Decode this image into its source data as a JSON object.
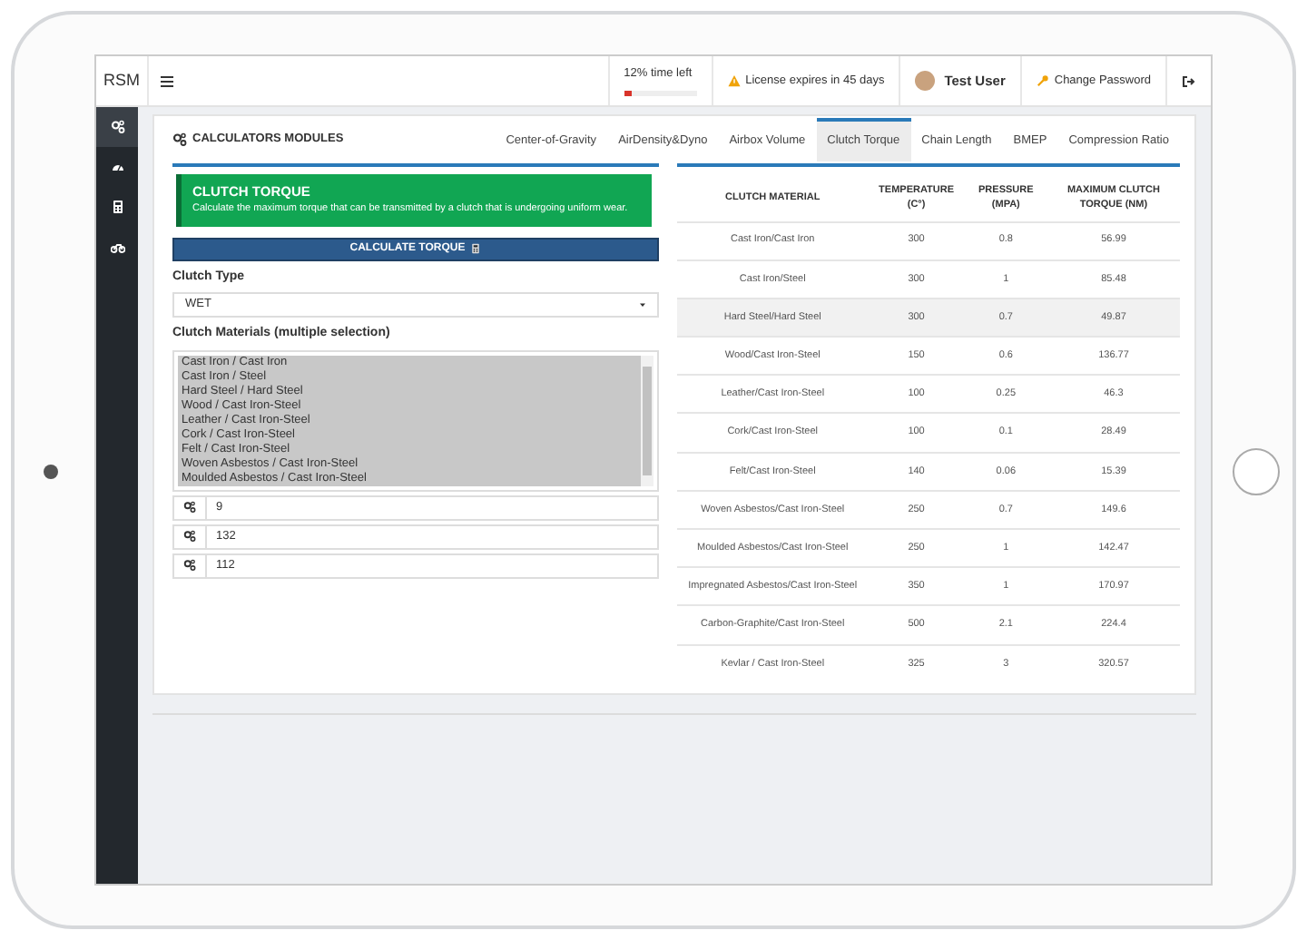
{
  "header": {
    "brand": "RSM",
    "time_left": {
      "label": "12% time left",
      "level": 0.12
    },
    "license": "License expires in 45 days",
    "user": "Test User",
    "change_password": "Change Password"
  },
  "sidebar": {
    "items": [
      {
        "kind": "gears",
        "selected": true
      },
      {
        "kind": "gauge",
        "selected": false
      },
      {
        "kind": "calculator",
        "selected": false
      },
      {
        "kind": "motorcycle",
        "selected": false
      }
    ]
  },
  "card": {
    "title": "CALCULATORS MODULES",
    "tabs": [
      {
        "label": "Center-of-Gravity",
        "selected": false
      },
      {
        "label": "AirDensity&Dyno",
        "selected": false
      },
      {
        "label": "Airbox Volume",
        "selected": false
      },
      {
        "label": "Clutch Torque",
        "selected": true
      },
      {
        "label": "Chain Length",
        "selected": false
      },
      {
        "label": "BMEP",
        "selected": false
      },
      {
        "label": "Compression Ratio",
        "selected": false
      }
    ]
  },
  "alert": {
    "title": "CLUTCH TORQUE",
    "text": "Calculate the maximum torque that can be transmitted by a clutch that is undergoing uniform wear."
  },
  "calculate_button": "CALCULATE TORQUE",
  "clutch_type": {
    "label": "Clutch Type",
    "value": "WET"
  },
  "clutch_materials": {
    "label": "Clutch Materials (multiple selection)",
    "options": [
      {
        "label": "Cast Iron / Cast Iron",
        "selected": true
      },
      {
        "label": "Cast Iron / Steel",
        "selected": true
      },
      {
        "label": "Hard Steel / Hard Steel",
        "selected": true
      },
      {
        "label": "Wood / Cast Iron-Steel",
        "selected": true
      },
      {
        "label": "Leather / Cast Iron-Steel",
        "selected": true
      },
      {
        "label": "Cork / Cast Iron-Steel",
        "selected": true
      },
      {
        "label": "Felt / Cast Iron-Steel",
        "selected": true
      },
      {
        "label": "Woven Asbestos / Cast Iron-Steel",
        "selected": true
      },
      {
        "label": "Moulded Asbestos / Cast Iron-Steel",
        "selected": true
      }
    ]
  },
  "inputs": [
    {
      "value": "9"
    },
    {
      "value": "132"
    },
    {
      "value": "112"
    }
  ],
  "table": {
    "columns": [
      "CLUTCH MATERIAL",
      "TEMPERATURE (C°)",
      "PRESSURE (MPA)",
      "MAXIMUM CLUTCH TORQUE (NM)"
    ],
    "rows": [
      {
        "cells": [
          "Cast Iron/Cast Iron",
          "300",
          "0.8",
          "56.99"
        ],
        "hovered": false
      },
      {
        "cells": [
          "Cast Iron/Steel",
          "300",
          "1",
          "85.48"
        ],
        "hovered": false
      },
      {
        "cells": [
          "Hard Steel/Hard Steel",
          "300",
          "0.7",
          "49.87"
        ],
        "hovered": true
      },
      {
        "cells": [
          "Wood/Cast Iron-Steel",
          "150",
          "0.6",
          "136.77"
        ],
        "hovered": false
      },
      {
        "cells": [
          "Leather/Cast Iron-Steel",
          "100",
          "0.25",
          "46.3"
        ],
        "hovered": false
      },
      {
        "cells": [
          "Cork/Cast Iron-Steel",
          "100",
          "0.1",
          "28.49"
        ],
        "hovered": false
      },
      {
        "cells": [
          "Felt/Cast Iron-Steel",
          "140",
          "0.06",
          "15.39"
        ],
        "hovered": false
      },
      {
        "cells": [
          "Woven Asbestos/Cast Iron-Steel",
          "250",
          "0.7",
          "149.6"
        ],
        "hovered": false
      },
      {
        "cells": [
          "Moulded Asbestos/Cast Iron-Steel",
          "250",
          "1",
          "142.47"
        ],
        "hovered": false
      },
      {
        "cells": [
          "Impregnated Asbestos/Cast Iron-Steel",
          "350",
          "1",
          "170.97"
        ],
        "hovered": false
      },
      {
        "cells": [
          "Carbon-Graphite/Cast Iron-Steel",
          "500",
          "2.1",
          "224.4"
        ],
        "hovered": false
      },
      {
        "cells": [
          "Kevlar / Cast Iron-Steel",
          "325",
          "3",
          "320.57"
        ],
        "hovered": false
      }
    ]
  }
}
